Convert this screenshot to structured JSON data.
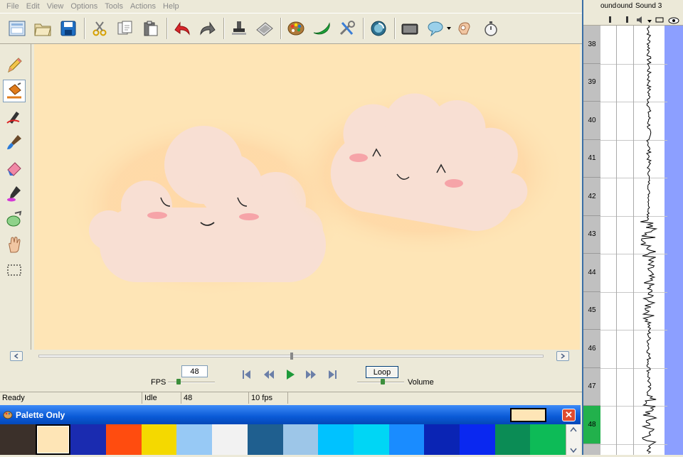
{
  "menu": [
    "File",
    "Edit",
    "View",
    "Options",
    "Tools",
    "Actions",
    "Help"
  ],
  "toolbar": {
    "buttons": [
      "new-icon",
      "open-folder-icon",
      "save-icon",
      "cut-scissors-icon",
      "copy-icon",
      "paste-icon",
      "undo-icon",
      "redo-icon",
      "stamp-icon",
      "light-table-icon",
      "color-palette-icon",
      "brush-stroke-icon",
      "tools-icon",
      "rotate-icon",
      "camera-icon",
      "speech-bubble-icon",
      "onion-skin-icon",
      "stopwatch-icon"
    ]
  },
  "tools": [
    "pencil-icon",
    "paint-bucket-icon",
    "ink-pen-icon",
    "paint-brush-icon",
    "eraser-icon",
    "dropper-icon",
    "fill-pot-icon",
    "hand-icon",
    "selection-icon"
  ],
  "playback": {
    "fps_label": "FPS",
    "fps_value": "48",
    "loop_label": "Loop",
    "volume_label": "Volume",
    "fps_level": 0.2,
    "volume_level": 0.55,
    "timeline_position": 0.5
  },
  "status": {
    "ready": "Ready",
    "state": "Idle",
    "frame": "48",
    "fps": "10 fps"
  },
  "timeline": {
    "columns": [
      "ound",
      "ound",
      "Sound 3"
    ],
    "frames": [
      "38",
      "39",
      "40",
      "41",
      "42",
      "43",
      "44",
      "45",
      "46",
      "47",
      "48"
    ],
    "current_frame": "48"
  },
  "palette": {
    "title": "Palette Only",
    "close_label": "✕",
    "current_color": "#fee5b6",
    "swatches": [
      "#3b302a",
      "#fee5b6",
      "#1a2bb0",
      "#ff4c0f",
      "#f4d900",
      "#97c9f5",
      "#f2f2f2",
      "#1f5f8f",
      "#9dc6e8",
      "#00c2ff",
      "#00d6f5",
      "#1a8cff",
      "#0a24b4",
      "#0a28f0",
      "#0b8c55",
      "#0dbb57"
    ],
    "selected_index": 1
  },
  "colors": {
    "canvas_bg": "#fee5b6",
    "cloud": "#f8dfd3",
    "blush": "#f6a4a8",
    "timeline_current": "#22b14c"
  }
}
